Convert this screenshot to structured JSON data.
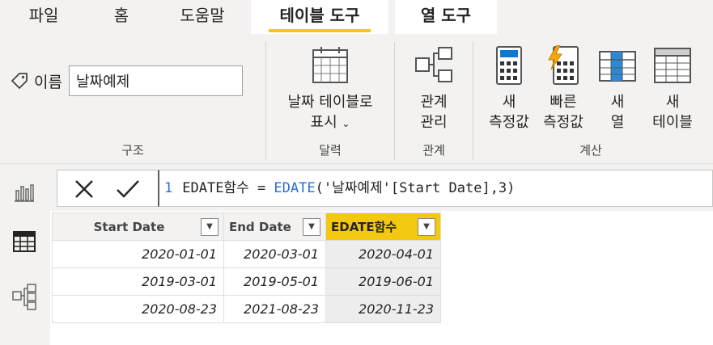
{
  "tabs": [
    {
      "label": "파일"
    },
    {
      "label": "홈"
    },
    {
      "label": "도움말"
    },
    {
      "label": "테이블 도구"
    },
    {
      "label": "열 도구"
    }
  ],
  "ribbon": {
    "structure": {
      "name_label": "이름",
      "name_value": "날짜예제",
      "group_label": "구조"
    },
    "calendar": {
      "button_line1": "날짜 테이블로",
      "button_line2": "표시",
      "group_label": "달력"
    },
    "relationships": {
      "button_line1": "관계",
      "button_line2": "관리",
      "group_label": "관계"
    },
    "calculations": {
      "new_measure_line1": "새",
      "new_measure_line2": "측정값",
      "quick_measure_line1": "빠른",
      "quick_measure_line2": "측정값",
      "new_column_line1": "새",
      "new_column_line2": "열",
      "new_table_line1": "새",
      "new_table_line2": "테이블",
      "group_label": "계산"
    }
  },
  "formula": {
    "line_number": "1",
    "lhs": "EDATE함수 = ",
    "func": "EDATE",
    "args": "('날짜예제'[Start Date],3)"
  },
  "table": {
    "columns": [
      {
        "label": "Start Date"
      },
      {
        "label": "End Date"
      },
      {
        "label": "EDATE함수"
      }
    ],
    "rows": [
      [
        "2020-01-01",
        "2020-03-01",
        "2020-04-01"
      ],
      [
        "2019-03-01",
        "2019-05-01",
        "2019-06-01"
      ],
      [
        "2020-08-23",
        "2021-08-23",
        "2020-11-23"
      ]
    ]
  },
  "colors": {
    "accent": "#f2c811",
    "formula_keyword": "#2b6cd1"
  }
}
